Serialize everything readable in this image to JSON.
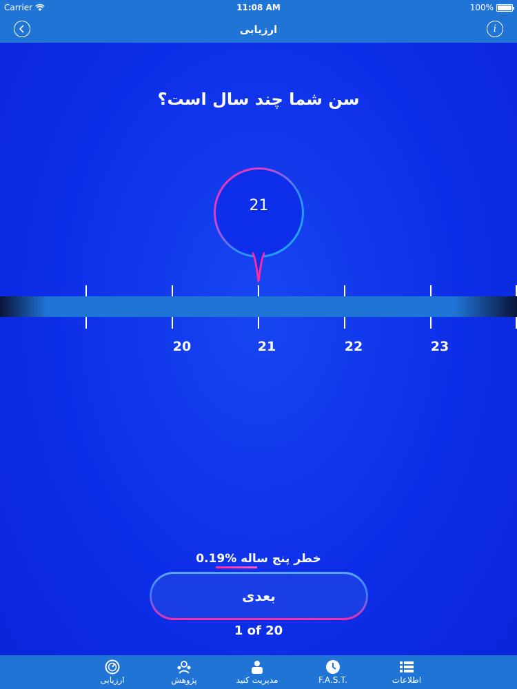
{
  "status_bar": {
    "carrier": "Carrier",
    "time": "11:08 AM",
    "battery": "100%"
  },
  "nav": {
    "title": "ارزیابی",
    "back_icon": "chevron-left-icon",
    "info_icon": "info-icon"
  },
  "question": "سن شما چند سال است؟",
  "selected_age": "21",
  "slider": {
    "tick_labels": [
      "20",
      "21",
      "22",
      "23"
    ]
  },
  "risk": {
    "label": "خطر پنج ساله",
    "value": "0.19%"
  },
  "next_button": {
    "label": "بعدی"
  },
  "progress": "1 of 20",
  "tabs": [
    {
      "label": "ارزیابی",
      "icon": "gauge-icon"
    },
    {
      "label": "پژوهش",
      "icon": "research-icon"
    },
    {
      "label": "مدیریت کنید",
      "icon": "manage-icon"
    },
    {
      "label": "F.A.S.T.",
      "icon": "clock-icon"
    },
    {
      "label": "اطلاعات",
      "icon": "list-icon"
    }
  ],
  "colors": {
    "accent": "#1f74d6",
    "background": "#0d2ee8",
    "highlight": "#ff2aa3"
  }
}
